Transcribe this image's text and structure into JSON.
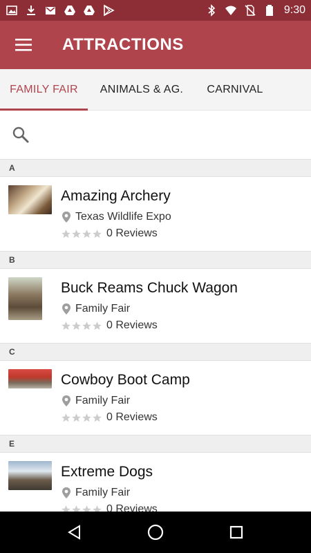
{
  "status_bar": {
    "time": "9:30",
    "left_icons": [
      "image-icon",
      "download-icon",
      "gmail-icon",
      "drive-icon",
      "drive-icon",
      "play-store-icon"
    ],
    "right_icons": [
      "bluetooth-icon",
      "wifi-icon",
      "no-sim-icon",
      "battery-icon"
    ]
  },
  "app_bar": {
    "title": "ATTRACTIONS",
    "menu_icon": "hamburger-menu-icon"
  },
  "tabs": [
    {
      "label": "FAMILY FAIR",
      "active": true
    },
    {
      "label": "ANIMALS & AG.",
      "active": false
    },
    {
      "label": "CARNIVAL",
      "active": false
    }
  ],
  "search": {
    "placeholder": "",
    "value": "",
    "icon": "search-icon"
  },
  "sections": [
    {
      "letter": "A",
      "items": [
        {
          "title": "Amazing Archery",
          "location": "Texas Wildlife Expo",
          "rating_stars": 0,
          "reviews": "0 Reviews"
        }
      ]
    },
    {
      "letter": "B",
      "items": [
        {
          "title": "Buck Reams Chuck Wagon",
          "location": "Family Fair",
          "rating_stars": 0,
          "reviews": "0 Reviews"
        }
      ]
    },
    {
      "letter": "C",
      "items": [
        {
          "title": "Cowboy Boot Camp",
          "location": "Family Fair",
          "rating_stars": 0,
          "reviews": "0 Reviews"
        }
      ]
    },
    {
      "letter": "E",
      "items": [
        {
          "title": "Extreme Dogs",
          "location": "Family Fair",
          "rating_stars": 0,
          "reviews": "0 Reviews"
        }
      ]
    }
  ],
  "colors": {
    "status_bar": "#8d2e36",
    "app_bar": "#b0444d",
    "accent": "#b0444d",
    "tab_bar": "#f4f4f4",
    "section_header": "#efefef",
    "star_empty": "#cccccc",
    "nav_bar": "#000000"
  },
  "nav_bar": {
    "icons": [
      "back-icon",
      "home-icon",
      "recents-icon"
    ]
  }
}
